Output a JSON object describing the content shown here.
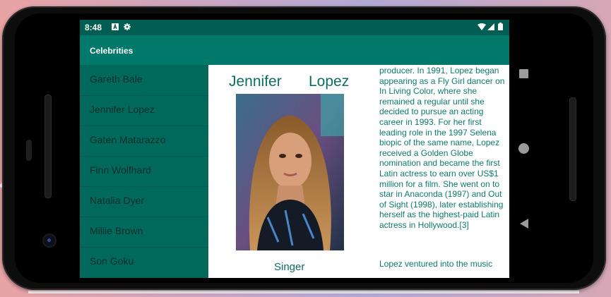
{
  "status_bar": {
    "time": "8:48"
  },
  "app_bar": {
    "title": "Celebrities"
  },
  "sidebar": {
    "items": [
      {
        "label": "Gareth Bale"
      },
      {
        "label": "Jennifer Lopez"
      },
      {
        "label": "Gaten Matarazzo"
      },
      {
        "label": "Finn Wolfhard"
      },
      {
        "label": "Natalia Dyer"
      },
      {
        "label": "Millie Brown"
      },
      {
        "label": "Son Goku"
      }
    ]
  },
  "detail": {
    "first_name": "Jennifer",
    "last_name": "Lopez",
    "role": "Singer",
    "description": "producer. In 1991, Lopez began appearing as a Fly Girl dancer on In Living Color, where she remained a regular until she decided to pursue an acting career in 1993. For her first leading role in the 1997 Selena biopic of the same name, Lopez received a Golden Globe nomination and became the first Latin actress to earn over US$1 million for a film. She went on to star in Anaconda (1997) and Out of Sight (1998), later establishing herself as the highest-paid Latin actress in Hollywood.[3]",
    "description_more": "Lopez ventured into the music"
  },
  "colors": {
    "status_bar": "#005d52",
    "app_bar": "#00796b",
    "sidebar": "#00695c",
    "accent_text": "#0e6d61"
  }
}
